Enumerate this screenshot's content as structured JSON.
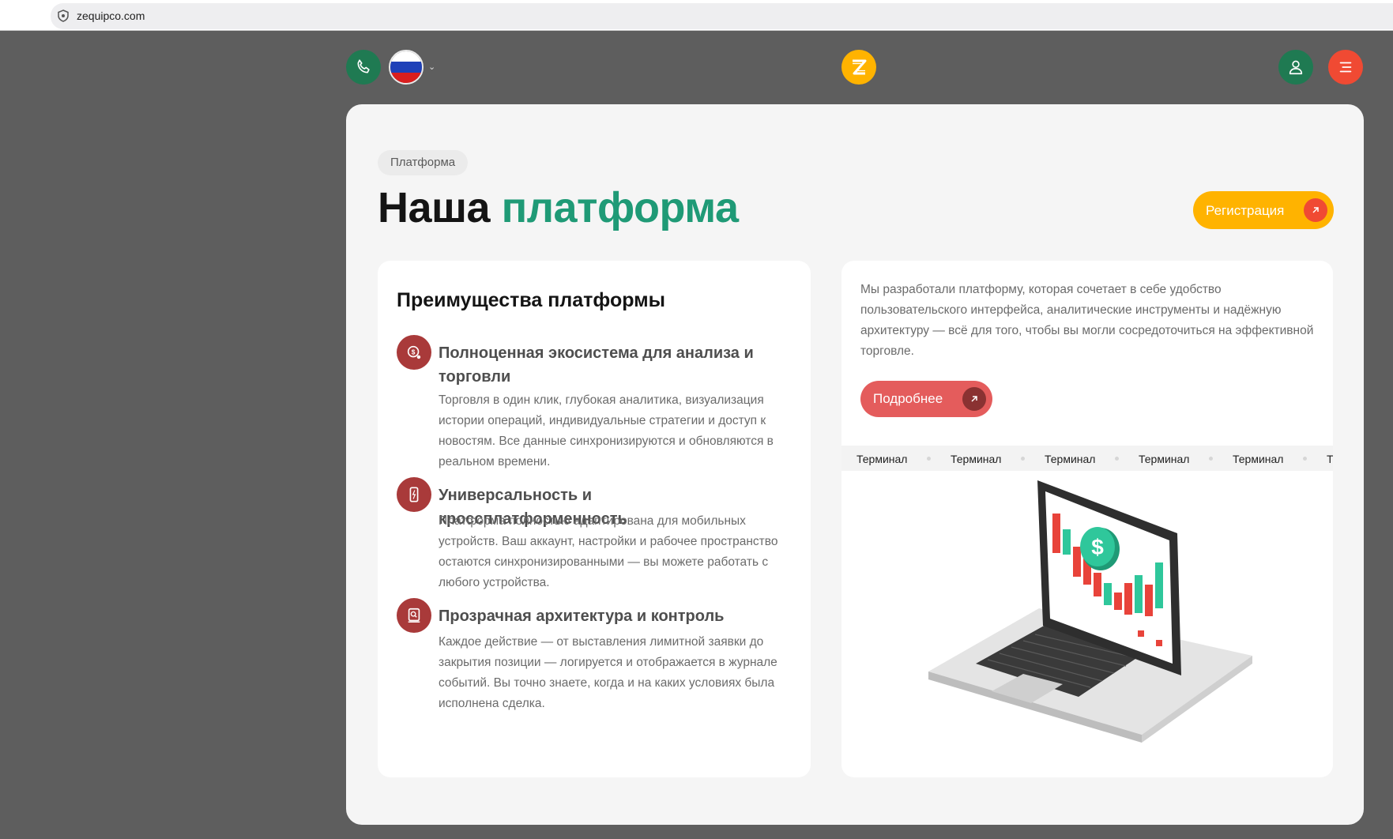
{
  "browser": {
    "url": "zequipco.com"
  },
  "header": {
    "icons": {
      "phone": "phone-icon",
      "flag": "russia-flag-icon",
      "chevron": "chevron-down-icon",
      "logo": "z-logo-icon",
      "user": "user-icon",
      "menu": "menu-icon"
    }
  },
  "section": {
    "chip": "Платформа",
    "title_main": "Наша",
    "title_accent": "платформа",
    "register_label": "Регистрация"
  },
  "advantages": {
    "heading": "Преимущества платформы",
    "items": [
      {
        "title": "Полноценная экосистема для анализа и торговли",
        "text": "Торговля в один клик, глубокая аналитика, визуализация истории операций, индивидуальные стратегии и доступ к новостям. Все данные синхронизируются и обновляются в реальном времени.",
        "icon": "coin-search-icon"
      },
      {
        "title": "Универсальность и кроссплатформенность",
        "text": "Платформа полностью адаптирована для мобильных устройств. Ваш аккаунт, настройки и рабочее пространство остаются синхронизированными — вы можете работать с любого устройства.",
        "icon": "mobile-icon"
      },
      {
        "title": "Прозрачная архитектура и контроль",
        "text": "Каждое действие — от выставления лимитной заявки до закрытия позиции — логируется и отображается в журнале событий. Вы точно знаете, когда и на каких условиях была исполнена сделка.",
        "icon": "document-check-icon"
      }
    ]
  },
  "intro": {
    "text": "Мы разработали платформу, которая сочетает в себе удобство пользовательского интерфейса, аналитические инструменты и надёжную архитектуру — всё для того, чтобы вы могли сосредоточиться на эффективной торговле.",
    "more_label": "Подробнее"
  },
  "ticker": {
    "items": [
      "Терминал",
      "Терминал",
      "Терминал",
      "Терминал",
      "Терминал",
      "Т"
    ]
  },
  "colors": {
    "green": "#1f9a76",
    "yellow": "#ffb300",
    "red": "#f04a33",
    "maroon": "#a93a3a"
  }
}
